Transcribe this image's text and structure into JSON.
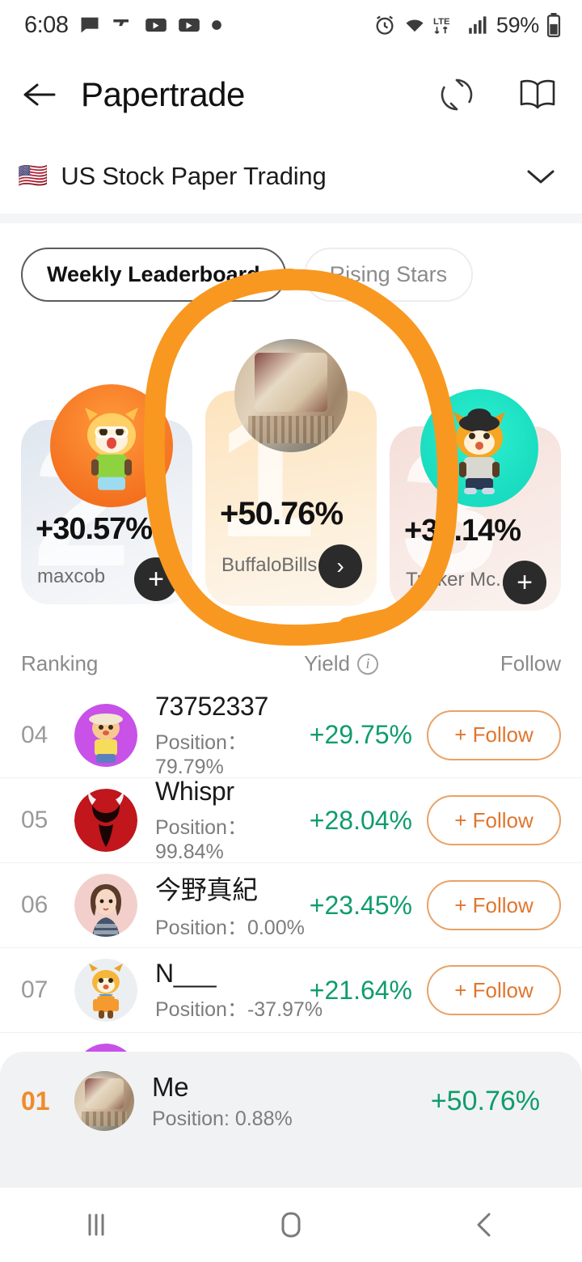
{
  "statusbar": {
    "time": "6:08",
    "battery": "59%",
    "network": "LTE",
    "icons": [
      "message-icon",
      "gun-icon",
      "video-icon",
      "video-icon",
      "dot-icon",
      "alarm-icon",
      "wifi-icon",
      "lte-icon",
      "signal-icon",
      "battery-icon"
    ]
  },
  "header": {
    "title": "Papertrade",
    "back_icon": "back-arrow-icon",
    "refresh_icon": "refresh-icon",
    "book_icon": "book-icon"
  },
  "market": {
    "flag": "🇺🇸",
    "name": "US Stock Paper Trading",
    "chevron": "chevron-down-icon"
  },
  "tabs": [
    {
      "label": "Weekly Leaderboard",
      "active": true
    },
    {
      "label": "Rising Stars",
      "active": false
    }
  ],
  "podium": [
    {
      "rank": "2",
      "yield": "+30.57%",
      "username": "maxcob",
      "action": "+",
      "avatar_type": "mascot-orange"
    },
    {
      "rank": "1",
      "yield": "+50.76%",
      "username": "BuffaloBills...",
      "action": "›",
      "avatar_type": "photo-relief"
    },
    {
      "rank": "3",
      "yield": "+30.14%",
      "username": "Tucker Mc...",
      "action": "+",
      "avatar_type": "mascot-teal"
    }
  ],
  "list_header": {
    "ranking": "Ranking",
    "yield": "Yield",
    "info_icon": "info-icon",
    "follow": "Follow"
  },
  "rows": [
    {
      "rank": "04",
      "username": "73752337",
      "position": "Position：79.79%",
      "yield": "+29.75%",
      "follow_label": "+ Follow",
      "avatar_color": "#c851e8"
    },
    {
      "rank": "05",
      "username": "Whispr",
      "position": "Position：99.84%",
      "yield": "+28.04%",
      "follow_label": "+ Follow",
      "avatar_color": "#c0161c"
    },
    {
      "rank": "06",
      "username": "今野真紀",
      "position": "Position：0.00%",
      "yield": "+23.45%",
      "follow_label": "+ Follow",
      "avatar_color": "#f0c8c4"
    },
    {
      "rank": "07",
      "username": "N___",
      "position": "Position：-37.97%",
      "yield": "+21.64%",
      "follow_label": "+ Follow",
      "avatar_color": "#e8ecef"
    }
  ],
  "me_row": {
    "rank": "01",
    "username": "Me",
    "position": "Position: 0.88%",
    "yield": "+50.76%"
  },
  "navbar": {
    "recents_icon": "recents-icon",
    "home_icon": "home-icon",
    "back_icon": "nav-back-icon"
  },
  "colors": {
    "yield_green": "#0f9d6b",
    "follow_orange": "#e0762e",
    "rank_orange": "#ef8b2c",
    "annotation_orange": "#f89820"
  }
}
